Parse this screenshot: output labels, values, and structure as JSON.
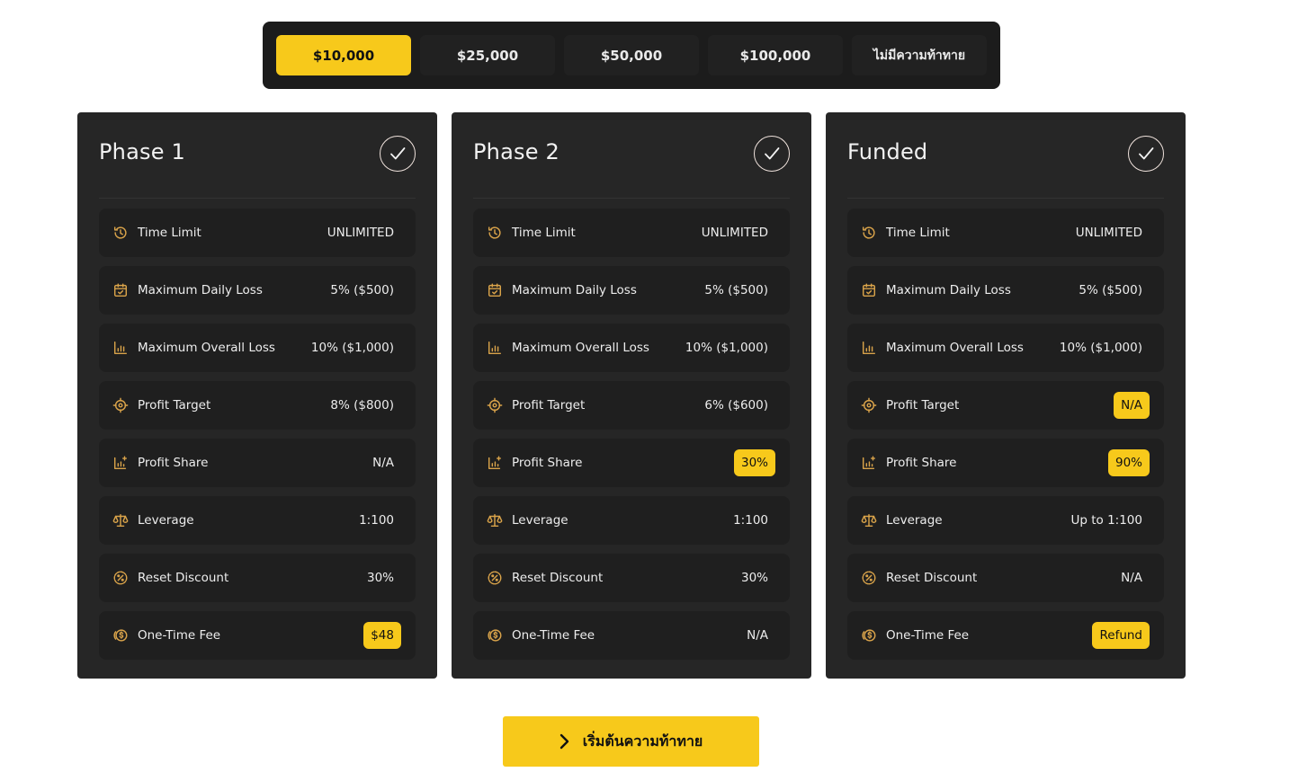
{
  "tabs": [
    {
      "label": "$10,000",
      "active": true
    },
    {
      "label": "$25,000",
      "active": false
    },
    {
      "label": "$50,000",
      "active": false
    },
    {
      "label": "$100,000",
      "active": false
    },
    {
      "label": "ไม่มีความท้าทาย",
      "active": false
    }
  ],
  "accent_color": "#f7c91b",
  "cards": [
    {
      "title": "Phase 1",
      "icon": "check-circle-icon",
      "rows": [
        {
          "icon": "history-icon",
          "label": "Time Limit",
          "value": "UNLIMITED"
        },
        {
          "icon": "calendar-icon",
          "label": "Maximum Daily Loss",
          "value": "5% ($500)"
        },
        {
          "icon": "bar-chart-icon",
          "label": "Maximum Overall Loss",
          "value": "10% ($1,000)"
        },
        {
          "icon": "target-icon",
          "label": "Profit Target",
          "value": "8% ($800)"
        },
        {
          "icon": "chart-plus-icon",
          "label": "Profit Share",
          "value": "N/A"
        },
        {
          "icon": "scale-icon",
          "label": "Leverage",
          "value": "1:100"
        },
        {
          "icon": "discount-icon",
          "label": "Reset Discount",
          "value": "30%"
        },
        {
          "icon": "coin-icon",
          "label": "One-Time Fee",
          "value": "$48"
        }
      ]
    },
    {
      "title": "Phase 2",
      "icon": "check-circle-icon",
      "rows": [
        {
          "icon": "history-icon",
          "label": "Time Limit",
          "value": "UNLIMITED"
        },
        {
          "icon": "calendar-icon",
          "label": "Maximum Daily Loss",
          "value": "5% ($500)"
        },
        {
          "icon": "bar-chart-icon",
          "label": "Maximum Overall Loss",
          "value": "10% ($1,000)"
        },
        {
          "icon": "target-icon",
          "label": "Profit Target",
          "value": "6% ($600)"
        },
        {
          "icon": "chart-plus-icon",
          "label": "Profit Share",
          "value": "30%"
        },
        {
          "icon": "scale-icon",
          "label": "Leverage",
          "value": "1:100"
        },
        {
          "icon": "discount-icon",
          "label": "Reset Discount",
          "value": "30%"
        },
        {
          "icon": "coin-icon",
          "label": "One-Time Fee",
          "value": "N/A"
        }
      ]
    },
    {
      "title": "Funded",
      "icon": "check-circle-icon",
      "rows": [
        {
          "icon": "history-icon",
          "label": "Time Limit",
          "value": "UNLIMITED"
        },
        {
          "icon": "calendar-icon",
          "label": "Maximum Daily Loss",
          "value": "5% ($500)"
        },
        {
          "icon": "bar-chart-icon",
          "label": "Maximum Overall Loss",
          "value": "10% ($1,000)"
        },
        {
          "icon": "target-icon",
          "label": "Profit Target",
          "value": "N/A"
        },
        {
          "icon": "chart-plus-icon",
          "label": "Profit Share",
          "value": "90%"
        },
        {
          "icon": "scale-icon",
          "label": "Leverage",
          "value": "Up to 1:100"
        },
        {
          "icon": "discount-icon",
          "label": "Reset Discount",
          "value": "N/A"
        },
        {
          "icon": "coin-icon",
          "label": "One-Time Fee",
          "value": "Refund"
        }
      ]
    }
  ],
  "cta": {
    "label": "เริ่มต้นความท้าทาย",
    "icon": "chevron-right-icon"
  }
}
